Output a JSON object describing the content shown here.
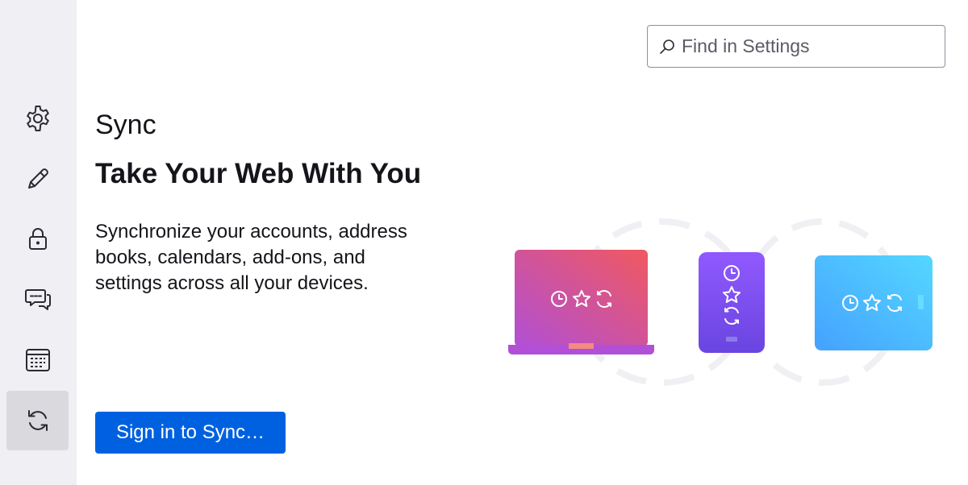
{
  "sidebar": {
    "items": [
      {
        "icon": "gear-icon",
        "label": "General",
        "selected": false
      },
      {
        "icon": "pencil-icon",
        "label": "Compose",
        "selected": false
      },
      {
        "icon": "lock-icon",
        "label": "Privacy & Security",
        "selected": false
      },
      {
        "icon": "chat-icon",
        "label": "Chat",
        "selected": false
      },
      {
        "icon": "calendar-icon",
        "label": "Calendar",
        "selected": false
      },
      {
        "icon": "sync-icon",
        "label": "Sync",
        "selected": true
      }
    ]
  },
  "search": {
    "placeholder": "Find in Settings",
    "icon": "search-icon"
  },
  "main": {
    "section_title": "Sync",
    "heading": "Take Your Web With You",
    "description": "Synchronize your accounts, address books, calendars, add-ons, and settings across all your devices.",
    "signin_button_label": "Sign in to Sync…"
  },
  "colors": {
    "sidebar_bg": "#f0f0f4",
    "sidebar_selected": "#d9d9de",
    "accent": "#0061e0",
    "laptop_gradient": [
      "#b14fd6",
      "#f0595f"
    ],
    "phone_gradient": [
      "#9059ff",
      "#6a45e0"
    ],
    "tablet_gradient": [
      "#45a1ff",
      "#54d7ff"
    ]
  }
}
